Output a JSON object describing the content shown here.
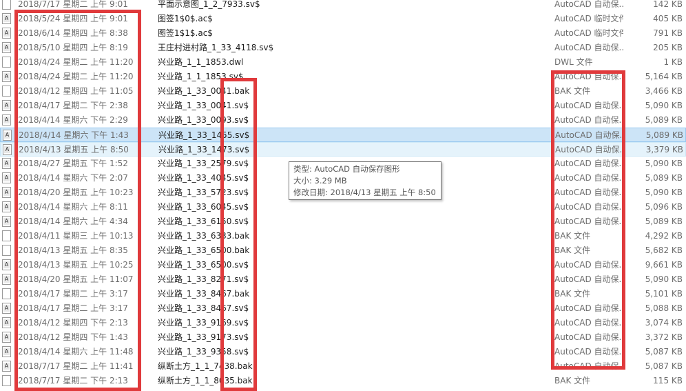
{
  "rows": [
    {
      "icon": "file-icon",
      "date": "2018/7/17 星期二 上午 9:01",
      "name": "平面示意图_1_2_7933.sv$",
      "type": "AutoCAD 自动保...",
      "size": "142 KB"
    },
    {
      "icon": "cad-file-icon",
      "date": "2018/5/24 星期四 上午 9:01",
      "name": "图签1$0$.ac$",
      "type": "AutoCAD 临时文件",
      "size": "405 KB"
    },
    {
      "icon": "cad-file-icon",
      "date": "2018/6/14 星期四 上午 8:38",
      "name": "图签1$1$.ac$",
      "type": "AutoCAD 临时文件",
      "size": "791 KB"
    },
    {
      "icon": "cad-file-icon",
      "date": "2018/5/10 星期四 上午 8:19",
      "name": "王庄村进村路_1_33_4118.sv$",
      "type": "AutoCAD 自动保...",
      "size": "205 KB"
    },
    {
      "icon": "file-icon",
      "date": "2018/4/24 星期二 上午 11:20",
      "name": "兴业路_1_1_1853.dwl",
      "type": "DWL 文件",
      "size": "1 KB"
    },
    {
      "icon": "cad-file-icon",
      "date": "2018/4/24 星期二 上午 11:20",
      "name": "兴业路_1_1_1853.sv$",
      "type": "AutoCAD 自动保...",
      "size": "5,164 KB"
    },
    {
      "icon": "file-icon",
      "date": "2018/4/12 星期四 上午 11:05",
      "name": "兴业路_1_33_0041.bak",
      "type": "BAK 文件",
      "size": "3,466 KB"
    },
    {
      "icon": "cad-file-icon",
      "date": "2018/4/17 星期二 下午 2:38",
      "name": "兴业路_1_33_0041.sv$",
      "type": "AutoCAD 自动保...",
      "size": "5,090 KB"
    },
    {
      "icon": "cad-file-icon",
      "date": "2018/4/14 星期六 下午 2:29",
      "name": "兴业路_1_33_0093.sv$",
      "type": "AutoCAD 自动保...",
      "size": "5,089 KB"
    },
    {
      "icon": "cad-file-icon",
      "date": "2018/4/14 星期六 下午 1:43",
      "name": "兴业路_1_33_1455.sv$",
      "type": "AutoCAD 自动保...",
      "size": "5,089 KB",
      "state": "selected"
    },
    {
      "icon": "cad-file-icon",
      "date": "2018/4/13 星期五 上午 8:50",
      "name": "兴业路_1_33_1473.sv$",
      "type": "AutoCAD 自动保...",
      "size": "3,379 KB",
      "state": "hover"
    },
    {
      "icon": "cad-file-icon",
      "date": "2018/4/27 星期五 下午 1:52",
      "name": "兴业路_1_33_2579.sv$",
      "type": "AutoCAD 自动保...",
      "size": "5,090 KB"
    },
    {
      "icon": "cad-file-icon",
      "date": "2018/4/14 星期六 下午 2:07",
      "name": "兴业路_1_33_4045.sv$",
      "type": "AutoCAD 自动保...",
      "size": "5,089 KB"
    },
    {
      "icon": "cad-file-icon",
      "date": "2018/4/20 星期五 上午 10:23",
      "name": "兴业路_1_33_5723.sv$",
      "type": "AutoCAD 自动保...",
      "size": "5,090 KB"
    },
    {
      "icon": "cad-file-icon",
      "date": "2018/4/14 星期六 上午 8:11",
      "name": "兴业路_1_33_6045.sv$",
      "type": "AutoCAD 自动保...",
      "size": "5,096 KB"
    },
    {
      "icon": "cad-file-icon",
      "date": "2018/4/14 星期六 上午 4:34",
      "name": "兴业路_1_33_6150.sv$",
      "type": "AutoCAD 自动保...",
      "size": "5,089 KB"
    },
    {
      "icon": "file-icon",
      "date": "2018/4/11 星期三 上午 10:13",
      "name": "兴业路_1_33_6333.bak",
      "type": "BAK 文件",
      "size": "4,292 KB"
    },
    {
      "icon": "file-icon",
      "date": "2018/4/13 星期五 上午 8:35",
      "name": "兴业路_1_33_6500.bak",
      "type": "BAK 文件",
      "size": "5,682 KB"
    },
    {
      "icon": "cad-file-icon",
      "date": "2018/4/13 星期五 上午 10:25",
      "name": "兴业路_1_33_6500.sv$",
      "type": "AutoCAD 自动保...",
      "size": "9,661 KB"
    },
    {
      "icon": "cad-file-icon",
      "date": "2018/4/20 星期五 上午 11:07",
      "name": "兴业路_1_33_8271.sv$",
      "type": "AutoCAD 自动保...",
      "size": "5,090 KB"
    },
    {
      "icon": "file-icon",
      "date": "2018/4/17 星期二 上午 3:17",
      "name": "兴业路_1_33_8467.bak",
      "type": "BAK 文件",
      "size": "5,101 KB"
    },
    {
      "icon": "cad-file-icon",
      "date": "2018/4/17 星期二 上午 3:17",
      "name": "兴业路_1_33_8467.sv$",
      "type": "AutoCAD 自动保...",
      "size": "5,088 KB"
    },
    {
      "icon": "cad-file-icon",
      "date": "2018/4/12 星期四 下午 2:13",
      "name": "兴业路_1_33_9169.sv$",
      "type": "AutoCAD 自动保...",
      "size": "3,074 KB"
    },
    {
      "icon": "cad-file-icon",
      "date": "2018/4/12 星期四 下午 1:43",
      "name": "兴业路_1_33_9173.sv$",
      "type": "AutoCAD 自动保...",
      "size": "3,372 KB"
    },
    {
      "icon": "cad-file-icon",
      "date": "2018/4/14 星期六 上午 11:48",
      "name": "兴业路_1_33_9358.sv$",
      "type": "AutoCAD 自动保...",
      "size": "5,087 KB"
    },
    {
      "icon": "cad-file-icon",
      "date": "2018/7/17 星期二 上午 11:41",
      "name": "纵断土方_1_1_7438.bak",
      "type": "AutoCAD 自动保...",
      "size": "5,087 KB"
    },
    {
      "icon": "file-icon",
      "date": "2018/7/17 星期二 下午 2:13",
      "name": "纵断土方_1_1_8035.bak",
      "type": "BAK 文件",
      "size": "115 KB"
    }
  ],
  "tooltip": {
    "type_line": "类型: AutoCAD 自动保存图形",
    "size_line": "大小: 3.29 MB",
    "date_line": "修改日期: 2018/4/13 星期五 上午 8:50"
  },
  "colors": {
    "annotation": "#e03a3c",
    "selection": "#cce4f7",
    "hover": "#e5f3fb"
  }
}
